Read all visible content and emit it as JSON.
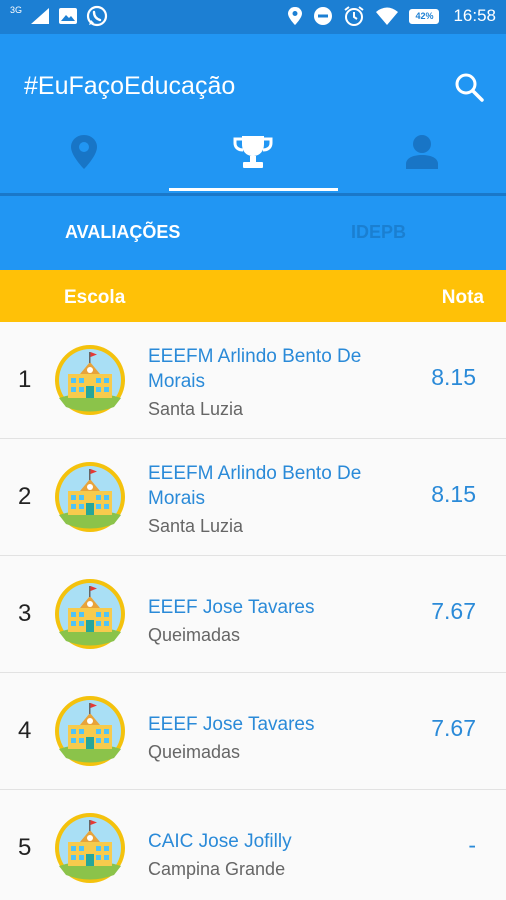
{
  "status_bar": {
    "network": "3G",
    "battery": "42%",
    "time": "16:58"
  },
  "app": {
    "title": "#EuFaçoEducação"
  },
  "nav_tabs": [
    "location-icon",
    "trophy-icon",
    "person-icon"
  ],
  "subtabs": {
    "active": "AVALIAÇÕES",
    "inactive": "IDEPB"
  },
  "table": {
    "header_school": "Escola",
    "header_grade": "Nota",
    "rows": [
      {
        "rank": "1",
        "name": "EEEFM Arlindo Bento De Morais",
        "city": "Santa Luzia",
        "score": "8.15"
      },
      {
        "rank": "2",
        "name": "EEEFM Arlindo Bento De Morais",
        "city": "Santa Luzia",
        "score": "8.15"
      },
      {
        "rank": "3",
        "name": "EEEF Jose Tavares",
        "city": "Queimadas",
        "score": "7.67"
      },
      {
        "rank": "4",
        "name": "EEEF Jose Tavares",
        "city": "Queimadas",
        "score": "7.67"
      },
      {
        "rank": "5",
        "name": "CAIC Jose Jofilly",
        "city": "Campina Grande",
        "score": "-"
      }
    ]
  },
  "colors": {
    "primary": "#2196f3",
    "status_bar": "#1c7fd3",
    "header_accent": "#ffc107",
    "link": "#2a8ad8"
  }
}
